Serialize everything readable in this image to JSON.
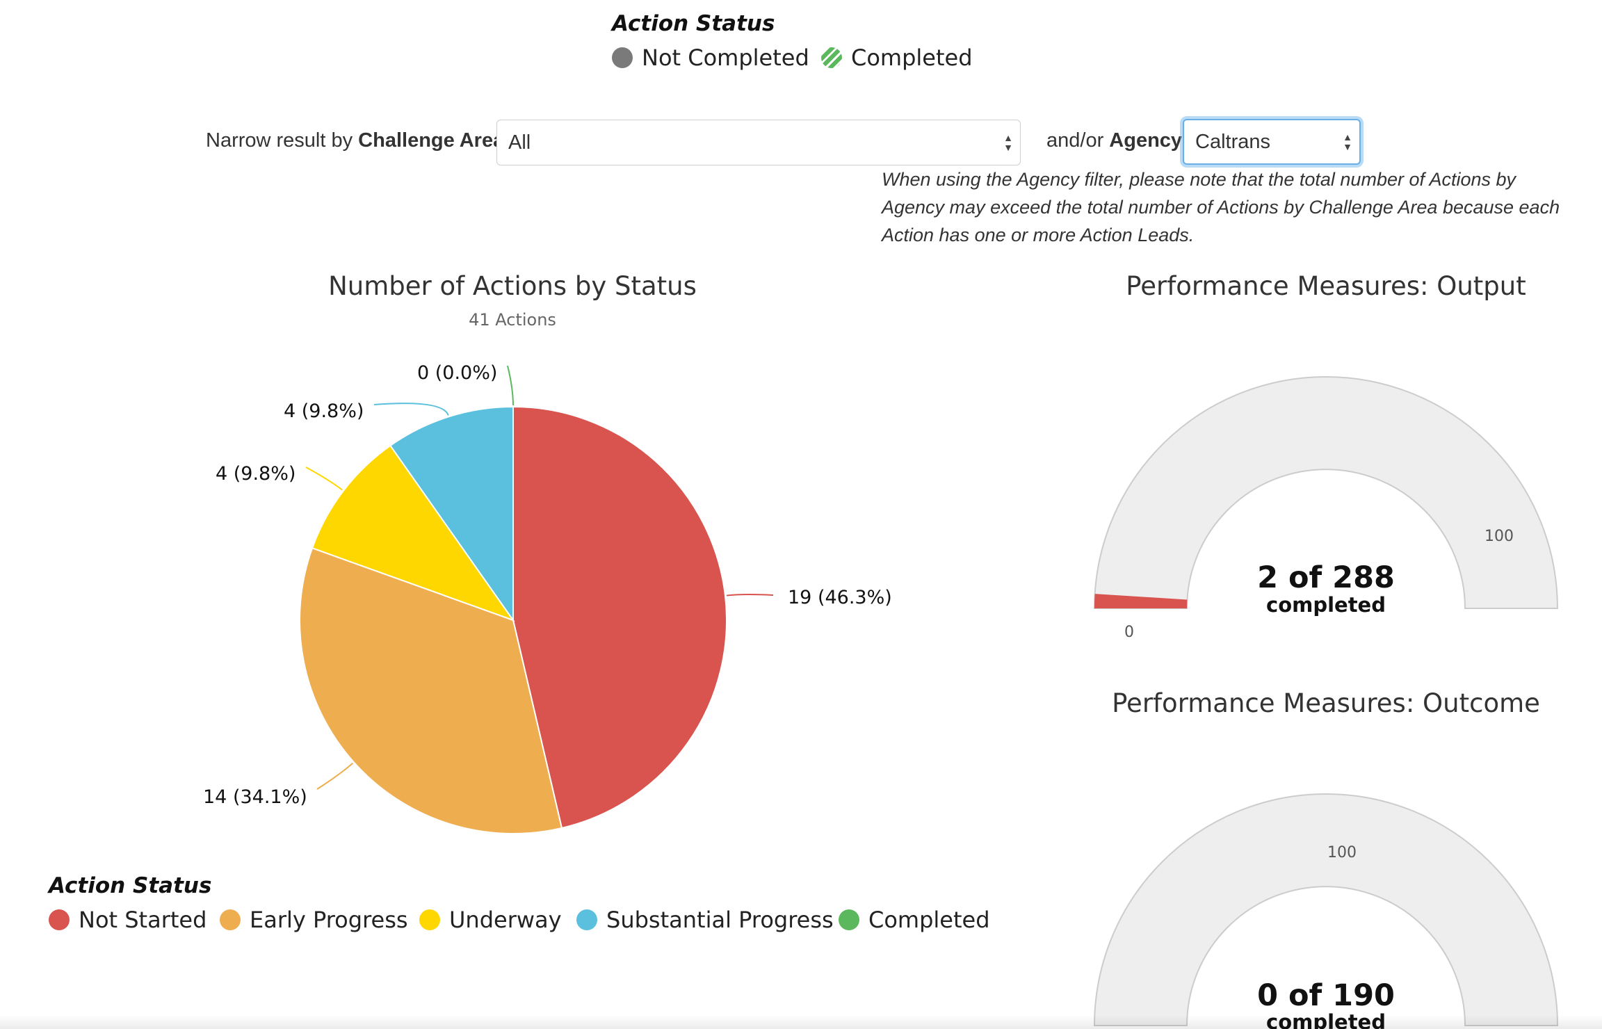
{
  "top_legend": {
    "title": "Action Status",
    "items": [
      {
        "label": "Not Completed",
        "color": "#7a7a7a",
        "icon": "filled-circle"
      },
      {
        "label": "Completed",
        "color": "#5cb85c",
        "icon": "striped-circle"
      }
    ]
  },
  "filters": {
    "challenge_prefix": "Narrow result by ",
    "challenge_bold": "Challenge Area",
    "challenge_value": "All",
    "agency_prefix": "and/or ",
    "agency_bold": "Agency",
    "agency_value": "Caltrans",
    "note": "When using the Agency filter, please note that the total number of Actions by Agency may exceed the total number of Actions by Challenge Area because each Action has one or more Action Leads."
  },
  "pie_chart": {
    "title": "Number of Actions by Status",
    "subtitle": "41 Actions",
    "labels": [
      "19 (46.3%)",
      "14 (34.1%)",
      "4 (9.8%)",
      "4 (9.8%)",
      "0 (0.0%)"
    ]
  },
  "bottom_legend": {
    "title": "Action Status",
    "items": [
      {
        "label": "Not Started",
        "color": "#d9534f"
      },
      {
        "label": "Early Progress",
        "color": "#eead4f"
      },
      {
        "label": "Underway",
        "color": "#ffd700"
      },
      {
        "label": "Substantial Progress",
        "color": "#5bc0de"
      },
      {
        "label": "Completed",
        "color": "#5cb85c"
      }
    ]
  },
  "gauge_output": {
    "title": "Performance Measures: Output",
    "value_text": "2 of 288",
    "sub_text": "completed",
    "min_label": "0",
    "max_label": "100"
  },
  "gauge_outcome": {
    "title": "Performance Measures: Outcome",
    "value_text": "0 of 190",
    "sub_text": "completed",
    "max_label": "100"
  },
  "chart_data": [
    {
      "type": "pie",
      "title": "Number of Actions by Status",
      "subtitle": "41 Actions",
      "categories": [
        "Not Started",
        "Early Progress",
        "Underway",
        "Substantial Progress",
        "Completed"
      ],
      "values": [
        19,
        14,
        4,
        4,
        0
      ],
      "percentages": [
        46.3,
        34.1,
        9.8,
        9.8,
        0.0
      ],
      "colors": [
        "#d9534f",
        "#eead4f",
        "#ffd700",
        "#5bc0de",
        "#5cb85c"
      ],
      "legend": "bottom-left"
    },
    {
      "type": "gauge",
      "title": "Performance Measures: Output",
      "value": 2,
      "total": 288,
      "min": 0,
      "max": 100,
      "fill_color": "#d9534f"
    },
    {
      "type": "gauge",
      "title": "Performance Measures: Outcome",
      "value": 0,
      "total": 190,
      "min": 0,
      "max": 100,
      "fill_color": "#d9534f"
    }
  ]
}
